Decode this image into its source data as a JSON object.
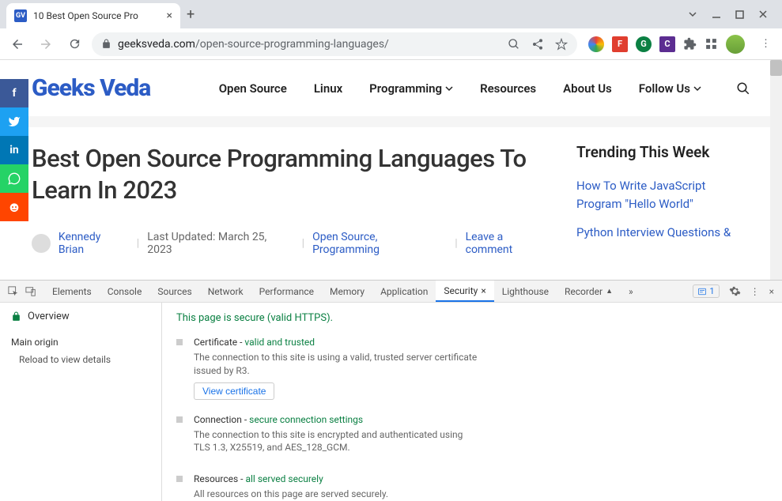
{
  "browser": {
    "tab_favicon": "GV",
    "tab_title": "10 Best Open Source Pro",
    "url_host": "geeksveda.com",
    "url_path": "/open-source-programming-languages/"
  },
  "page": {
    "logo": "Geeks Veda",
    "nav": [
      "Open Source",
      "Linux",
      "Programming",
      "Resources",
      "About Us",
      "Follow Us"
    ],
    "article_title": "Best Open Source Programming Languages To Learn In 2023",
    "author": "Kennedy Brian",
    "updated": "Last Updated: March 25, 2023",
    "categories": "Open Source, Programming",
    "comment": "Leave a comment",
    "trending_heading": "Trending This Week",
    "trending": [
      "How To Write JavaScript Program \"Hello World\"",
      "Python Interview Questions &"
    ]
  },
  "devtools": {
    "tabs": [
      "Elements",
      "Console",
      "Sources",
      "Network",
      "Performance",
      "Memory",
      "Application",
      "Security",
      "Lighthouse",
      "Recorder"
    ],
    "active_tab": "Security",
    "issue_count": "1",
    "overview": "Overview",
    "main_origin": "Main origin",
    "reload": "Reload to view details",
    "banner": "This page is secure (valid HTTPS).",
    "cert_label": "Certificate - ",
    "cert_status": "valid and trusted",
    "cert_desc": "The connection to this site is using a valid, trusted server certificate issued by R3.",
    "view_cert": "View certificate",
    "conn_label": "Connection - ",
    "conn_status": "secure connection settings",
    "conn_desc": "The connection to this site is encrypted and authenticated using TLS 1.3, X25519, and AES_128_GCM.",
    "res_label": "Resources - ",
    "res_status": "all served securely",
    "res_desc": "All resources on this page are served securely."
  }
}
